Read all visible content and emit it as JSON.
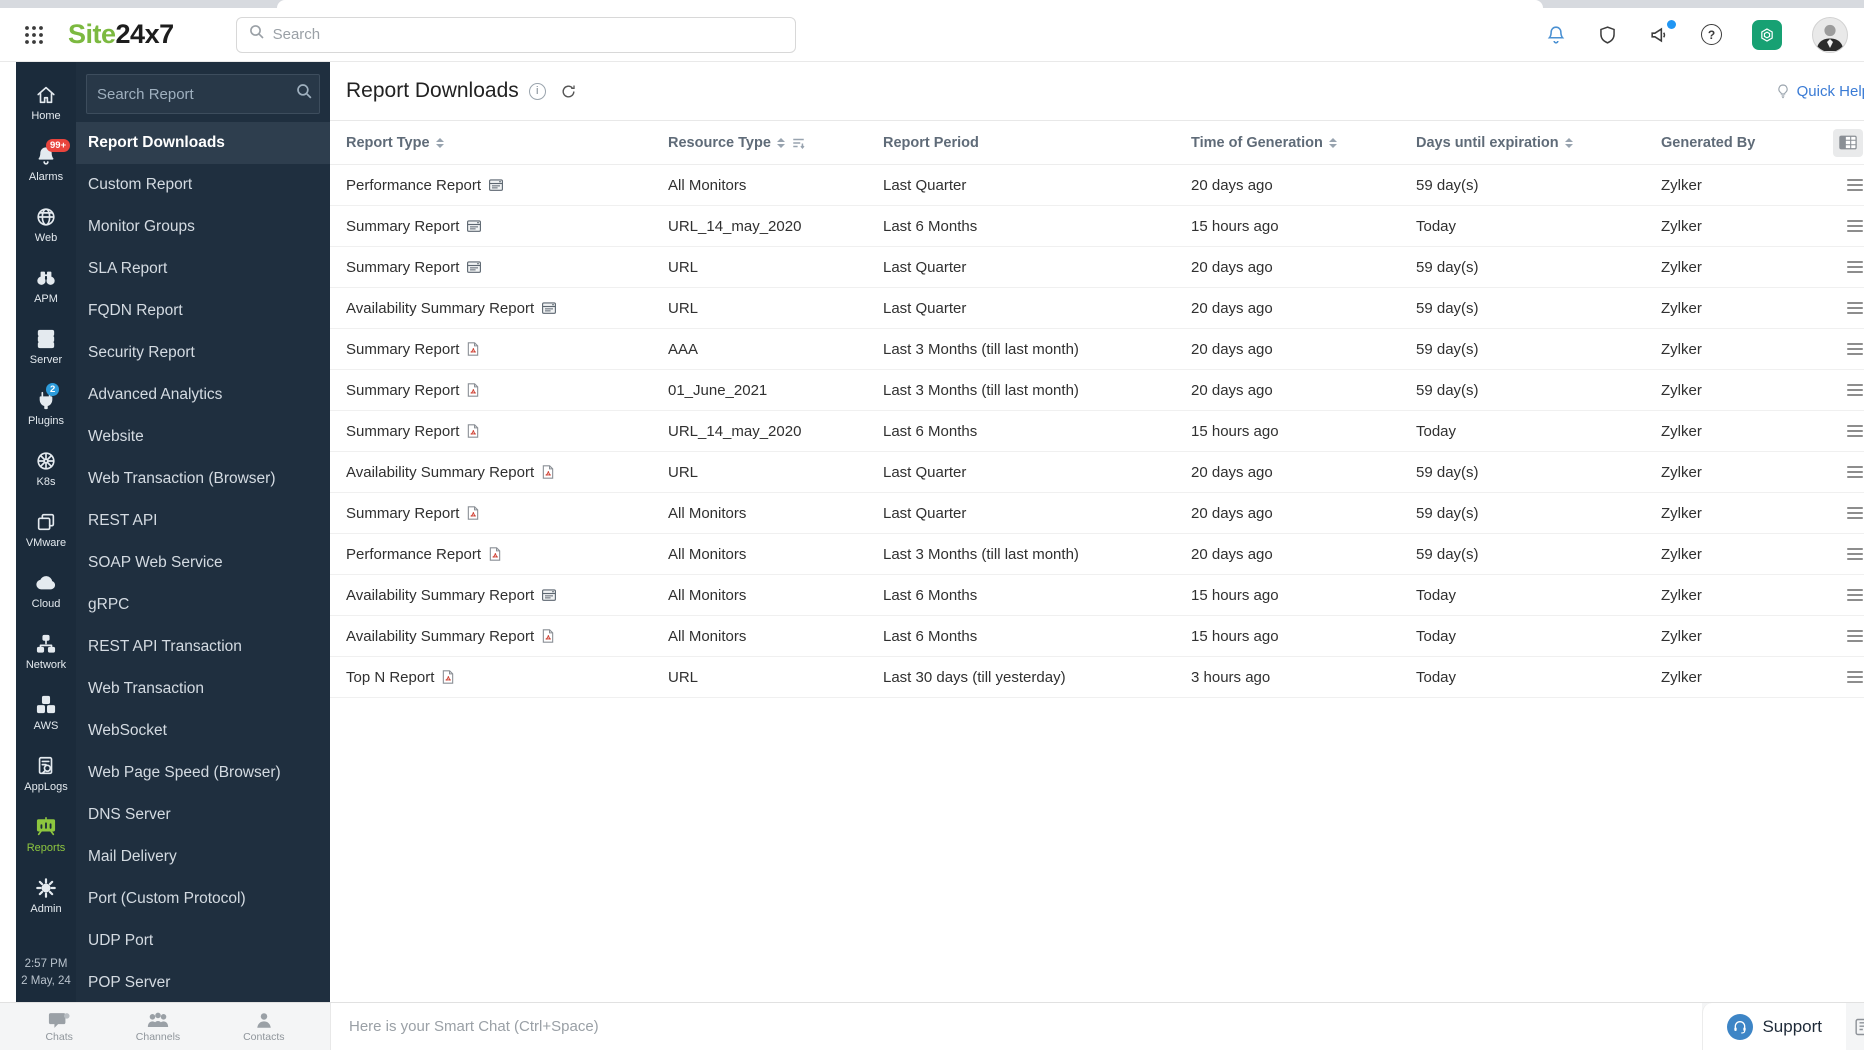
{
  "topbar": {
    "search_placeholder": "Search",
    "logo_green": "Site",
    "logo_dark": "24x7"
  },
  "rail": {
    "items": [
      {
        "label": "Home",
        "icon": "home"
      },
      {
        "label": "Alarms",
        "icon": "bell-solid",
        "badge": "99+",
        "badge_color": "red"
      },
      {
        "label": "Web",
        "icon": "globe"
      },
      {
        "label": "APM",
        "icon": "binoculars"
      },
      {
        "label": "Server",
        "icon": "server"
      },
      {
        "label": "Plugins",
        "icon": "plug",
        "badge": "2",
        "badge_color": "blue"
      },
      {
        "label": "K8s",
        "icon": "k8s"
      },
      {
        "label": "VMware",
        "icon": "vmware"
      },
      {
        "label": "Cloud",
        "icon": "cloud"
      },
      {
        "label": "Network",
        "icon": "network"
      },
      {
        "label": "AWS",
        "icon": "aws"
      },
      {
        "label": "AppLogs",
        "icon": "applogs"
      },
      {
        "label": "Reports",
        "icon": "reports",
        "active": true
      },
      {
        "label": "Admin",
        "icon": "gear"
      }
    ],
    "timestamp_time": "2:57 PM",
    "timestamp_date": "2 May, 24"
  },
  "sidebar": {
    "search_placeholder": "Search Report",
    "items": [
      {
        "label": "Report Downloads",
        "active": true
      },
      {
        "label": "Custom Report"
      },
      {
        "label": "Monitor Groups"
      },
      {
        "label": "SLA Report"
      },
      {
        "label": "FQDN Report"
      },
      {
        "label": "Security Report"
      },
      {
        "label": "Advanced Analytics"
      },
      {
        "label": "Website"
      },
      {
        "label": "Web Transaction (Browser)"
      },
      {
        "label": "REST API"
      },
      {
        "label": "SOAP Web Service"
      },
      {
        "label": "gRPC"
      },
      {
        "label": "REST API Transaction"
      },
      {
        "label": "Web Transaction"
      },
      {
        "label": "WebSocket"
      },
      {
        "label": "Web Page Speed (Browser)"
      },
      {
        "label": "DNS Server"
      },
      {
        "label": "Mail Delivery"
      },
      {
        "label": "Port (Custom Protocol)"
      },
      {
        "label": "UDP Port"
      },
      {
        "label": "POP Server"
      }
    ]
  },
  "main": {
    "title": "Report Downloads",
    "quick_help": "Quick Help",
    "table": {
      "columns": [
        {
          "label": "Report Type",
          "sortable": true
        },
        {
          "label": "Resource Type",
          "sortable": true,
          "filter": true
        },
        {
          "label": "Report Period"
        },
        {
          "label": "Time of Generation",
          "sortable": true
        },
        {
          "label": "Days until expiration",
          "sortable": true
        },
        {
          "label": "Generated By"
        }
      ],
      "rows": [
        {
          "report_type": "Performance Report",
          "file_type": "csv",
          "resource_type": "All Monitors",
          "report_period": "Last Quarter",
          "time_of_generation": "20 days ago",
          "days_until_expiration": "59 day(s)",
          "generated_by": "Zylker"
        },
        {
          "report_type": "Summary Report",
          "file_type": "csv",
          "resource_type": "URL_14_may_2020",
          "report_period": "Last 6 Months",
          "time_of_generation": "15 hours ago",
          "days_until_expiration": "Today",
          "generated_by": "Zylker"
        },
        {
          "report_type": "Summary Report",
          "file_type": "csv",
          "resource_type": "URL",
          "report_period": "Last Quarter",
          "time_of_generation": "20 days ago",
          "days_until_expiration": "59 day(s)",
          "generated_by": "Zylker"
        },
        {
          "report_type": "Availability Summary Report",
          "file_type": "csv",
          "resource_type": "URL",
          "report_period": "Last Quarter",
          "time_of_generation": "20 days ago",
          "days_until_expiration": "59 day(s)",
          "generated_by": "Zylker"
        },
        {
          "report_type": "Summary Report",
          "file_type": "pdf",
          "resource_type": "AAA",
          "report_period": "Last 3 Months (till last month)",
          "time_of_generation": "20 days ago",
          "days_until_expiration": "59 day(s)",
          "generated_by": "Zylker"
        },
        {
          "report_type": "Summary Report",
          "file_type": "pdf",
          "resource_type": "01_June_2021",
          "report_period": "Last 3 Months (till last month)",
          "time_of_generation": "20 days ago",
          "days_until_expiration": "59 day(s)",
          "generated_by": "Zylker"
        },
        {
          "report_type": "Summary Report",
          "file_type": "pdf",
          "resource_type": "URL_14_may_2020",
          "report_period": "Last 6 Months",
          "time_of_generation": "15 hours ago",
          "days_until_expiration": "Today",
          "generated_by": "Zylker"
        },
        {
          "report_type": "Availability Summary Report",
          "file_type": "pdf",
          "resource_type": "URL",
          "report_period": "Last Quarter",
          "time_of_generation": "20 days ago",
          "days_until_expiration": "59 day(s)",
          "generated_by": "Zylker"
        },
        {
          "report_type": "Summary Report",
          "file_type": "pdf",
          "resource_type": "All Monitors",
          "report_period": "Last Quarter",
          "time_of_generation": "20 days ago",
          "days_until_expiration": "59 day(s)",
          "generated_by": "Zylker"
        },
        {
          "report_type": "Performance Report",
          "file_type": "pdf",
          "resource_type": "All Monitors",
          "report_period": "Last 3 Months (till last month)",
          "time_of_generation": "20 days ago",
          "days_until_expiration": "59 day(s)",
          "generated_by": "Zylker"
        },
        {
          "report_type": "Availability Summary Report",
          "file_type": "csv",
          "resource_type": "All Monitors",
          "report_period": "Last 6 Months",
          "time_of_generation": "15 hours ago",
          "days_until_expiration": "Today",
          "generated_by": "Zylker"
        },
        {
          "report_type": "Availability Summary Report",
          "file_type": "pdf",
          "resource_type": "All Monitors",
          "report_period": "Last 6 Months",
          "time_of_generation": "15 hours ago",
          "days_until_expiration": "Today",
          "generated_by": "Zylker"
        },
        {
          "report_type": "Top N Report",
          "file_type": "pdf",
          "resource_type": "URL",
          "report_period": "Last 30 days (till yesterday)",
          "time_of_generation": "3 hours ago",
          "days_until_expiration": "Today",
          "generated_by": "Zylker"
        }
      ]
    }
  },
  "bottombar": {
    "chats": "Chats",
    "channels": "Channels",
    "contacts": "Contacts",
    "smart_chat_placeholder": "Here is your Smart Chat (Ctrl+Space)",
    "support": "Support"
  },
  "colors": {
    "brand_green": "#7cb940",
    "reports_active_green": "#8dc63f",
    "alarm_badge_red": "#e9443d",
    "plugin_badge_blue": "#2d9cdb",
    "quick_help_blue": "#3a7bd5",
    "notification_dot_blue": "#2196f3",
    "rail_bg": "#1b2b3b",
    "sidebar_bg": "#1f2f3f",
    "support_icon_blue": "#3d85c6",
    "ai_button_green": "#17a173"
  }
}
